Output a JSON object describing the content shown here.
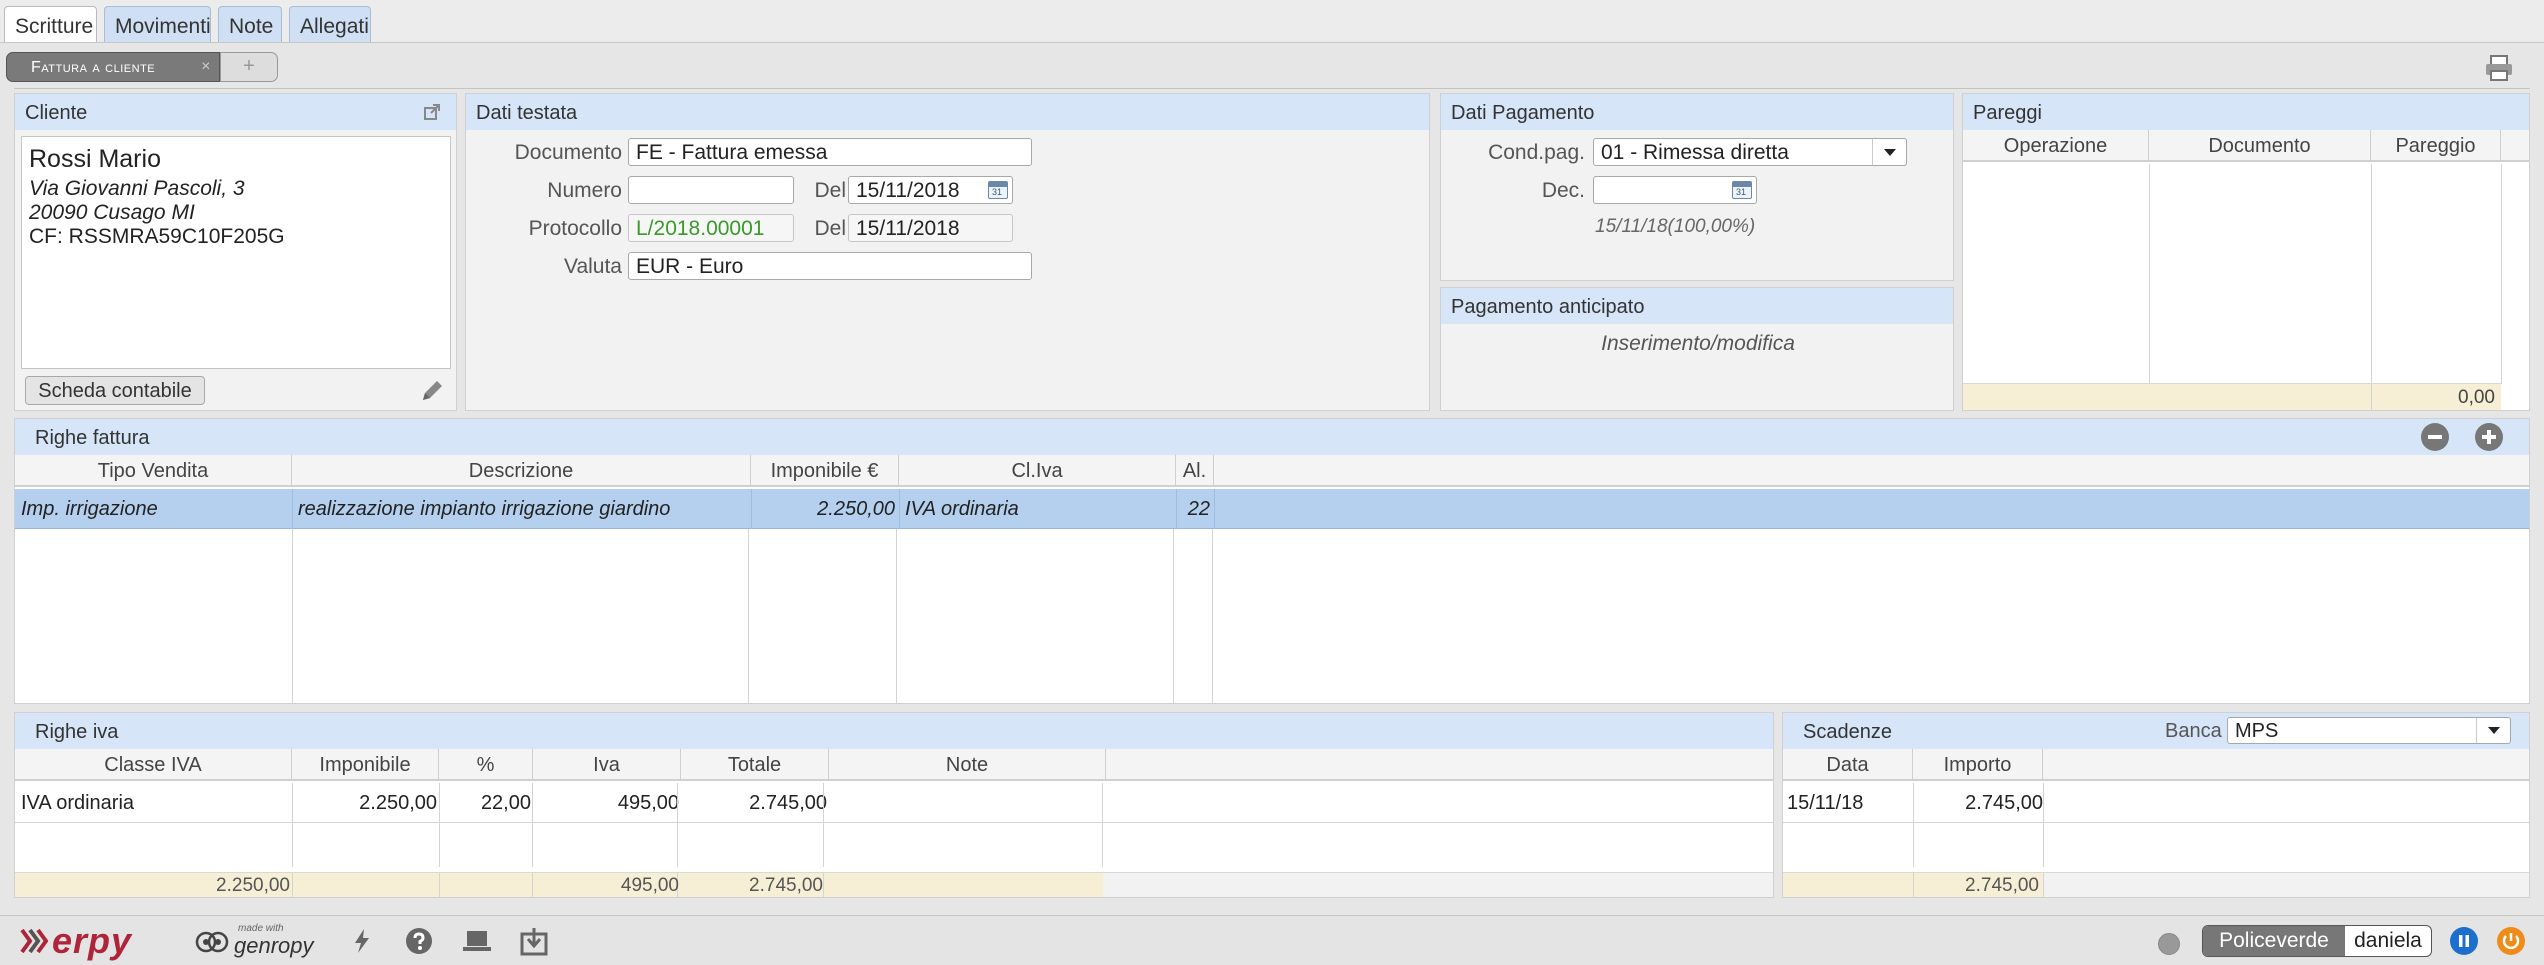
{
  "tabs": [
    {
      "label": "Scritture"
    },
    {
      "label": "Movimenti"
    },
    {
      "label": "Note"
    },
    {
      "label": "Allegati"
    }
  ],
  "subtabs": {
    "active": "Fattura a cliente",
    "close": "×",
    "add": "+"
  },
  "cliente": {
    "title": "Cliente",
    "name": "Rossi Mario",
    "address1": "Via Giovanni Pascoli, 3",
    "address2": "20090 Cusago  MI",
    "cf": "CF: RSSMRA59C10F205G",
    "scheda_button": "Scheda contabile"
  },
  "testata": {
    "title": "Dati testata",
    "documento_label": "Documento",
    "documento_value": "FE - Fattura emessa",
    "numero_label": "Numero",
    "numero_value": "",
    "del_label": "Del",
    "numero_date": "15/11/2018",
    "protocollo_label": "Protocollo",
    "protocollo_value": "L/2018.00001",
    "protocollo_del_label": "Del",
    "protocollo_date": "15/11/2018",
    "valuta_label": "Valuta",
    "valuta_value": "EUR - Euro"
  },
  "pagamento": {
    "title": "Dati Pagamento",
    "cond_label": "Cond.pag.",
    "cond_value": "01 - Rimessa diretta",
    "dec_label": "Dec.",
    "dec_value": "",
    "summary": "15/11/18(100,00%)"
  },
  "anticipato": {
    "title": "Pagamento anticipato",
    "text": "Inserimento/modifica"
  },
  "pareggi": {
    "title": "Pareggi",
    "columns": [
      "Operazione",
      "Documento",
      "Pareggio"
    ],
    "total": "0,00"
  },
  "righe_fattura": {
    "title": "Righe fattura",
    "columns": [
      "Tipo Vendita",
      "Descrizione",
      "Imponibile €",
      "Cl.Iva",
      "Al."
    ],
    "rows": [
      {
        "tipo": "Imp. irrigazione",
        "descrizione": "realizzazione impianto irrigazione giardino",
        "imponibile": "2.250,00",
        "cliva": "IVA ordinaria",
        "al": "22"
      }
    ]
  },
  "righe_iva": {
    "title": "Righe iva",
    "columns": [
      "Classe IVA",
      "Imponibile",
      "%",
      "Iva",
      "Totale",
      "Note"
    ],
    "rows": [
      {
        "classe": "IVA ordinaria",
        "imponibile": "2.250,00",
        "perc": "22,00",
        "iva": "495,00",
        "totale": "2.745,00",
        "note": ""
      }
    ],
    "totals": {
      "imponibile": "2.250,00",
      "iva": "495,00",
      "totale": "2.745,00"
    }
  },
  "scadenze": {
    "title": "Scadenze",
    "banca_label": "Banca",
    "banca_value": "MPS",
    "columns": [
      "Data",
      "Importo"
    ],
    "rows": [
      {
        "data": "15/11/18",
        "importo": "2.745,00"
      }
    ],
    "total": "2.745,00"
  },
  "footer": {
    "logo": "erpy",
    "made_with": "made with",
    "genropy": "genropy",
    "company": "Policeverde",
    "user": "daniela"
  },
  "colors": {
    "header_bg": "#d6e5f7",
    "selected_row": "#b5cfee",
    "totals_bg": "#f6efd6",
    "logo_red": "#b0243a",
    "accent_blue": "#1d6fcf",
    "power_orange": "#f08b1a"
  }
}
